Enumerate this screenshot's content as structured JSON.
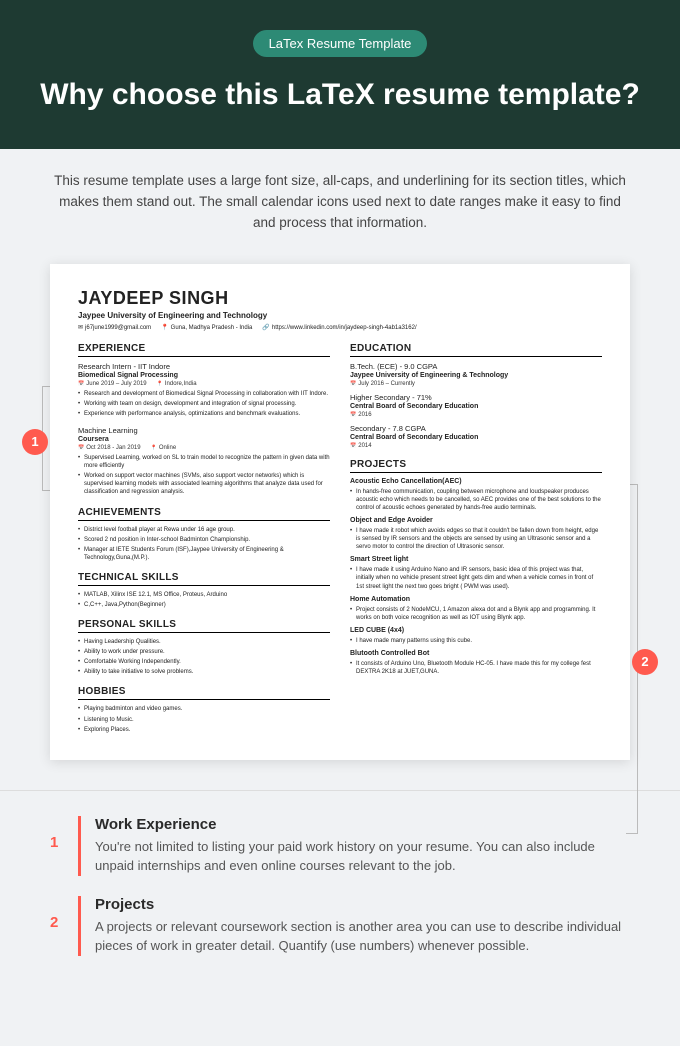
{
  "hero": {
    "badge": "LaTex Resume Template",
    "title": "Why choose this LaTeX resume template?"
  },
  "intro": "This resume template uses a large font size, all-caps, and underlining for its section titles, which makes them stand out. The small calendar icons used next to date ranges make it easy to find and process that information.",
  "callouts": {
    "c1": "1",
    "c2": "2"
  },
  "resume": {
    "name": "JAYDEEP SINGH",
    "subtitle": "Jaypee University of Engineering and Technology",
    "contact": {
      "email": "j67june1999@gmail.com",
      "location": "Guna, Madhya Pradesh - India",
      "link": "https://www.linkedin.com/in/jaydeep-singh-4ab1a3162/"
    },
    "left": {
      "experience": {
        "title": "EXPERIENCE",
        "jobs": [
          {
            "role": "Research Intern - IIT Indore",
            "sub": "Biomedical Signal Processing",
            "date": "June 2019 – July 2019",
            "loc": "Indore,India",
            "bullets": [
              "Research and development of Biomedical Signal Processing in collaboration with IIT Indore.",
              "Working with team on design, development and integration of signal processing.",
              "Experience with performance analysis, optimizations and benchmark evaluations."
            ]
          },
          {
            "role": "Machine Learning",
            "sub": "Coursera",
            "date": "Oct 2018 - Jan 2019",
            "loc": "Online",
            "bullets": [
              "Supervised Learning, worked on SL to train model to recognize the pattern in given data with more efficiently",
              "Worked on support vector machines (SVMs, also support vector networks) which is supervised learning models with associated learning algorithms that analyze data used for classification and regression analysis."
            ]
          }
        ]
      },
      "achievements": {
        "title": "ACHIEVEMENTS",
        "bullets": [
          "District level football player at Rewa under 16 age group.",
          "Scored 2 nd position in Inter-school Badminton Championship.",
          "Manager at IETE Students Forum (ISF),Jaypee University of Engineering & Technology,Guna,(M.P.)."
        ]
      },
      "techskills": {
        "title": "TECHNICAL SKILLS",
        "bullets": [
          "MATLAB, Xilinx ISE 12.1, MS Office, Proteus, Arduino",
          "C,C++, Java,Python(Beginner)"
        ]
      },
      "personalskills": {
        "title": "PERSONAL SKILLS",
        "bullets": [
          "Having Leadership Qualities.",
          "Ability to work under pressure.",
          "Comfortable Working Independently.",
          "Ability to take initiative to solve problems."
        ]
      },
      "hobbies": {
        "title": "HOBBIES",
        "bullets": [
          "Playing badminton and video games.",
          "Listening to Music.",
          "Exploring Places."
        ]
      }
    },
    "right": {
      "education": {
        "title": "EDUCATION",
        "items": [
          {
            "deg": "B.Tech. (ECE) - 9.0 CGPA",
            "school": "Jaypee University of Engineering & Technology",
            "date": "July 2016 – Currently"
          },
          {
            "deg": "Higher Secondary - 71%",
            "school": "Central Board of Secondary Education",
            "date": "2016"
          },
          {
            "deg": "Secondary - 7.8 CGPA",
            "school": "Central Board of Secondary Education",
            "date": "2014"
          }
        ]
      },
      "projects": {
        "title": "PROJECTS",
        "items": [
          {
            "name": "Acoustic Echo Cancellation(AEC)",
            "desc": "I have made it using Arduino Nano and IR sensors, basic idea of this project was that, initially when no vehicle present street light gets dim and when a vehicle comes in front of 1st street light the next two goes bright ( PWM was used).",
            "b": [
              "In hands-free communication, coupling between microphone and loudspeaker produces acoustic echo which needs to be cancelled, so AEC provides one of the best solutions to the control of acoustic echoes generated by hands-free audio terminals."
            ]
          },
          {
            "name": "Object and Edge Avoider",
            "b": [
              "I have made it robot which avoids edges so that it couldn't be fallen down from height, edge is sensed by IR sensors and the objects are sensed by using an Ultrasonic sensor and a servo motor to control the direction of Ultrasonic sensor."
            ]
          },
          {
            "name": "Smart Street light",
            "b": [
              "I have made it using Arduino Nano and IR sensors, basic idea of this project was that, initially when no vehicle present street light gets dim and when a vehicle comes in front of 1st street light the next two goes bright ( PWM was used)."
            ]
          },
          {
            "name": "Home Automation",
            "b": [
              "Project consists of 2 NodeMCU, 1 Amazon alexa dot and a Blynk app and programming. It works on both voice recognition as well as IOT using Blynk app."
            ]
          },
          {
            "name": "LED CUBE (4x4)",
            "b": [
              "I have made many patterns using this cube."
            ]
          },
          {
            "name": "Blutooth Controlled Bot",
            "b": [
              "It consists of Arduino Uno, Bluetooth Module HC-05. I have made this for my college fest DEXTRA 2K18 at JUET,GUNA."
            ]
          }
        ]
      }
    }
  },
  "annotations": [
    {
      "num": "1",
      "title": "Work Experience",
      "text": "You're not limited to listing your paid work history on your resume. You can also include unpaid internships and even online courses relevant to the job."
    },
    {
      "num": "2",
      "title": "Projects",
      "text": "A projects or relevant coursework section is another area you can use to describe individual pieces of work in greater detail. Quantify (use numbers) whenever possible."
    }
  ]
}
